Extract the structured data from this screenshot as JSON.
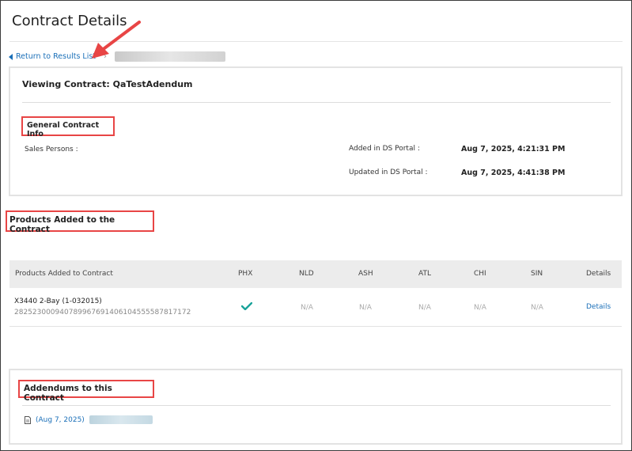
{
  "page": {
    "title": "Contract Details"
  },
  "breadcrumb": {
    "back_label": "Return to Results List"
  },
  "contract": {
    "viewing_label": "Viewing Contract: QaTestAdendum",
    "general_info_heading": "General Contract Info",
    "sales_persons_label": "Sales Persons :",
    "added_label": "Added in DS Portal :",
    "added_value": "Aug 7, 2025, 4:21:31 PM",
    "updated_label": "Updated in DS Portal :",
    "updated_value": "Aug 7, 2025, 4:41:38 PM"
  },
  "products": {
    "heading": "Products Added to the Contract",
    "columns": [
      "Products Added to Contract",
      "PHX",
      "NLD",
      "ASH",
      "ATL",
      "CHI",
      "SIN",
      "Details"
    ],
    "rows": [
      {
        "name": "X3440 2-Bay (1-032015)",
        "id": "28252300094078996769140610455558781717​2",
        "phx": "check",
        "nld": "N/A",
        "ash": "N/A",
        "atl": "N/A",
        "chi": "N/A",
        "sin": "N/A",
        "details": "Details"
      }
    ]
  },
  "addendums": {
    "heading": "Addendums to this Contract",
    "items": [
      {
        "date": "(Aug 7, 2025)",
        "icon": "document-icon"
      }
    ]
  },
  "colors": {
    "link": "#1a6fb8",
    "highlight": "#e84545",
    "check": "#1aa39a"
  }
}
